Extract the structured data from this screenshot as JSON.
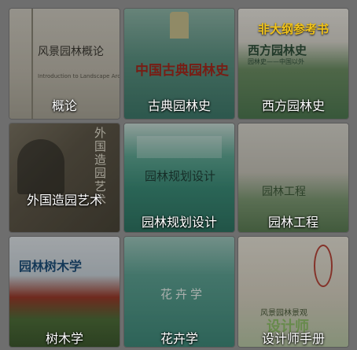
{
  "books": [
    {
      "label": "概论",
      "cover_title": "风景园林概论",
      "cover_subtitle": "Introduction to Landscape Architecture"
    },
    {
      "label": "古典园林史",
      "cover_title": "中国古典园林史"
    },
    {
      "label": "西方园林史",
      "cover_title": "西方园林史",
      "cover_subtitle": "园林史——中国以外",
      "badge": "非大纲参考书"
    },
    {
      "label": "外国造园艺术",
      "cover_title": "外国造园艺术"
    },
    {
      "label": "园林规划设计",
      "cover_title": "园林规划设计"
    },
    {
      "label": "园林工程",
      "cover_title": "园林工程"
    },
    {
      "label": "树木学",
      "cover_title": "园林树木学"
    },
    {
      "label": "花卉学",
      "cover_title": "花卉学"
    },
    {
      "label": "设计师手册",
      "cover_title": "风景园林景观",
      "cover_subtitle": "设计师"
    }
  ],
  "colors": {
    "background": "#6e6e6e",
    "badge": "#f2c318"
  }
}
